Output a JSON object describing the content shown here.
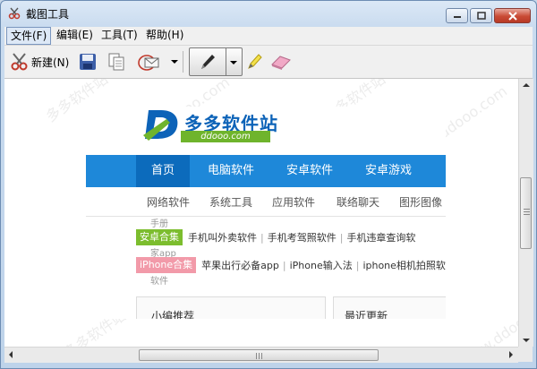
{
  "window": {
    "title": "截图工具",
    "controls": [
      "minimize",
      "maximize",
      "close"
    ]
  },
  "menu": [
    {
      "label": "文件(F)",
      "active": true
    },
    {
      "label": "编辑(E)",
      "active": false
    },
    {
      "label": "工具(T)",
      "active": false
    },
    {
      "label": "帮助(H)",
      "active": false
    }
  ],
  "toolbar": {
    "new_label": "新建(N)",
    "tools": [
      "scissors-icon",
      "save-icon",
      "copy-icon",
      "send-mail-icon",
      "pen-icon",
      "highlighter-icon",
      "eraser-icon"
    ]
  },
  "capture": {
    "logo_title": "多多软件站",
    "logo_url": "ddooo.com",
    "nav": [
      "首页",
      "电脑软件",
      "安卓软件",
      "安卓游戏"
    ],
    "subnav": [
      "网络软件",
      "系统工具",
      "应用软件",
      "联络聊天",
      "图形图像"
    ],
    "row1": {
      "tag": "安卓合集",
      "items": [
        "手机叫外卖软件",
        "手机考驾照软件",
        "手机违章查询软"
      ]
    },
    "row1_cut": "家app",
    "row2": {
      "tag": "iPhone合集",
      "items": [
        "苹果出行必备app",
        "iPhone输入法",
        "iphone相机拍照软"
      ]
    },
    "row2_cut": "软件",
    "box_left": "小编推荐",
    "box_right": "最近更新",
    "fragment_top": "手册"
  },
  "watermarks": [
    "多多软件站",
    "www.ddooo.com"
  ],
  "colors": {
    "nav_blue": "#1e88d9",
    "nav_home": "#0c6bbc",
    "tag_green": "#7cbd2e",
    "tag_pink": "#f29aa9",
    "logo_blue": "#0d63b8"
  }
}
